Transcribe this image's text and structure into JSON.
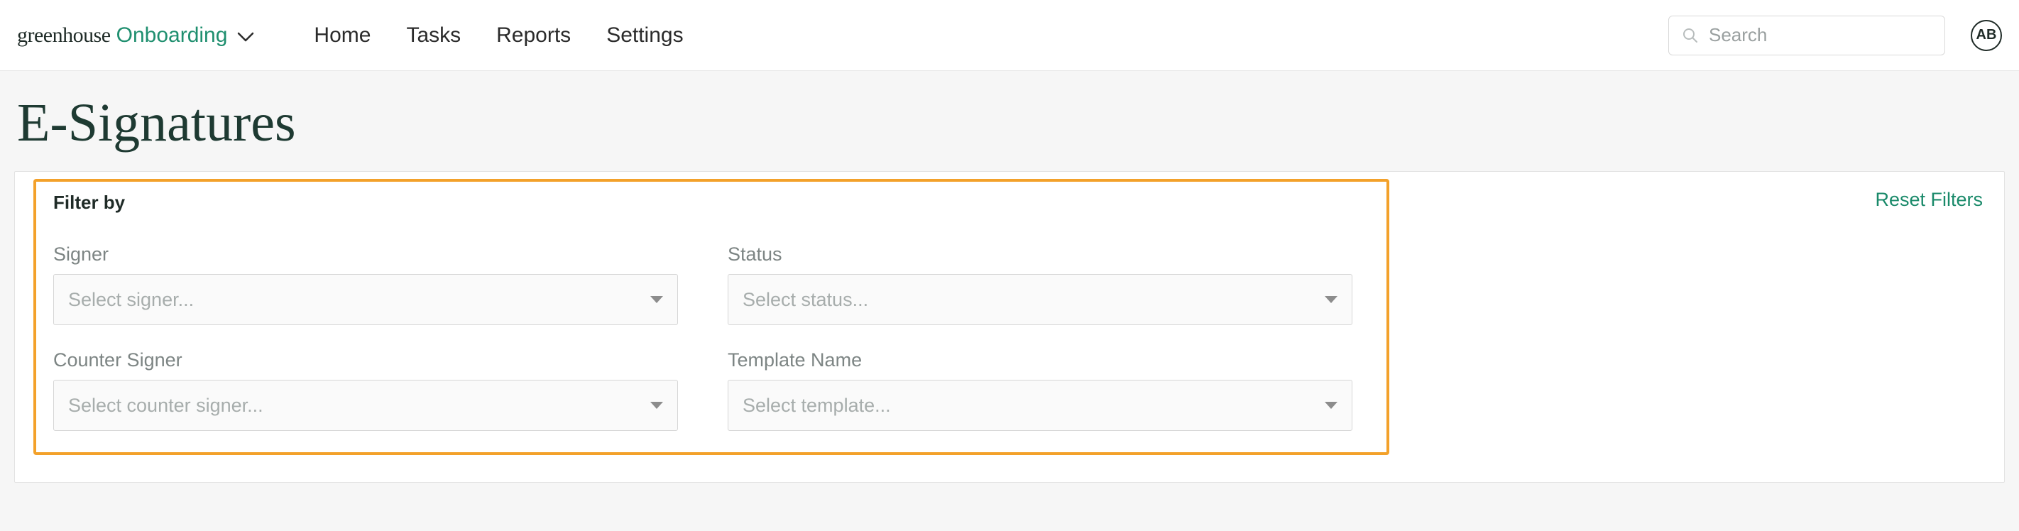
{
  "brand": {
    "greenhouse": "greenhouse",
    "onboarding": "Onboarding"
  },
  "nav": {
    "home": "Home",
    "tasks": "Tasks",
    "reports": "Reports",
    "settings": "Settings"
  },
  "search": {
    "placeholder": "Search"
  },
  "avatar": {
    "initials": "AB"
  },
  "page": {
    "title": "E-Signatures"
  },
  "filters": {
    "header": "Filter by",
    "reset": "Reset Filters",
    "signer": {
      "label": "Signer",
      "placeholder": "Select signer..."
    },
    "status": {
      "label": "Status",
      "placeholder": "Select status..."
    },
    "counter_signer": {
      "label": "Counter Signer",
      "placeholder": "Select counter signer..."
    },
    "template_name": {
      "label": "Template Name",
      "placeholder": "Select template..."
    }
  }
}
